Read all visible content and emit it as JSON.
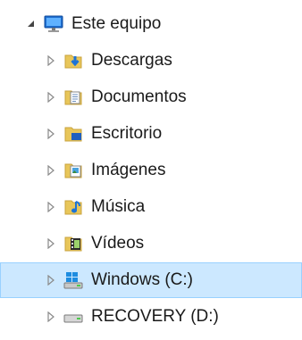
{
  "tree": {
    "root": {
      "label": "Este equipo",
      "icon": "computer-icon",
      "expanded": true
    },
    "children": [
      {
        "label": "Descargas",
        "icon": "downloads-folder-icon"
      },
      {
        "label": "Documentos",
        "icon": "documents-folder-icon"
      },
      {
        "label": "Escritorio",
        "icon": "desktop-folder-icon"
      },
      {
        "label": "Imágenes",
        "icon": "pictures-folder-icon"
      },
      {
        "label": "Música",
        "icon": "music-folder-icon"
      },
      {
        "label": "Vídeos",
        "icon": "videos-folder-icon"
      },
      {
        "label": "Windows (C:)",
        "icon": "system-drive-icon",
        "selected": true
      },
      {
        "label": "RECOVERY (D:)",
        "icon": "drive-icon"
      }
    ]
  },
  "colors": {
    "selection_bg": "#cce8ff",
    "selection_border": "#99d1ff",
    "folder_yellow": "#e8c65a",
    "arrow_gray": "#8a8a8a"
  }
}
